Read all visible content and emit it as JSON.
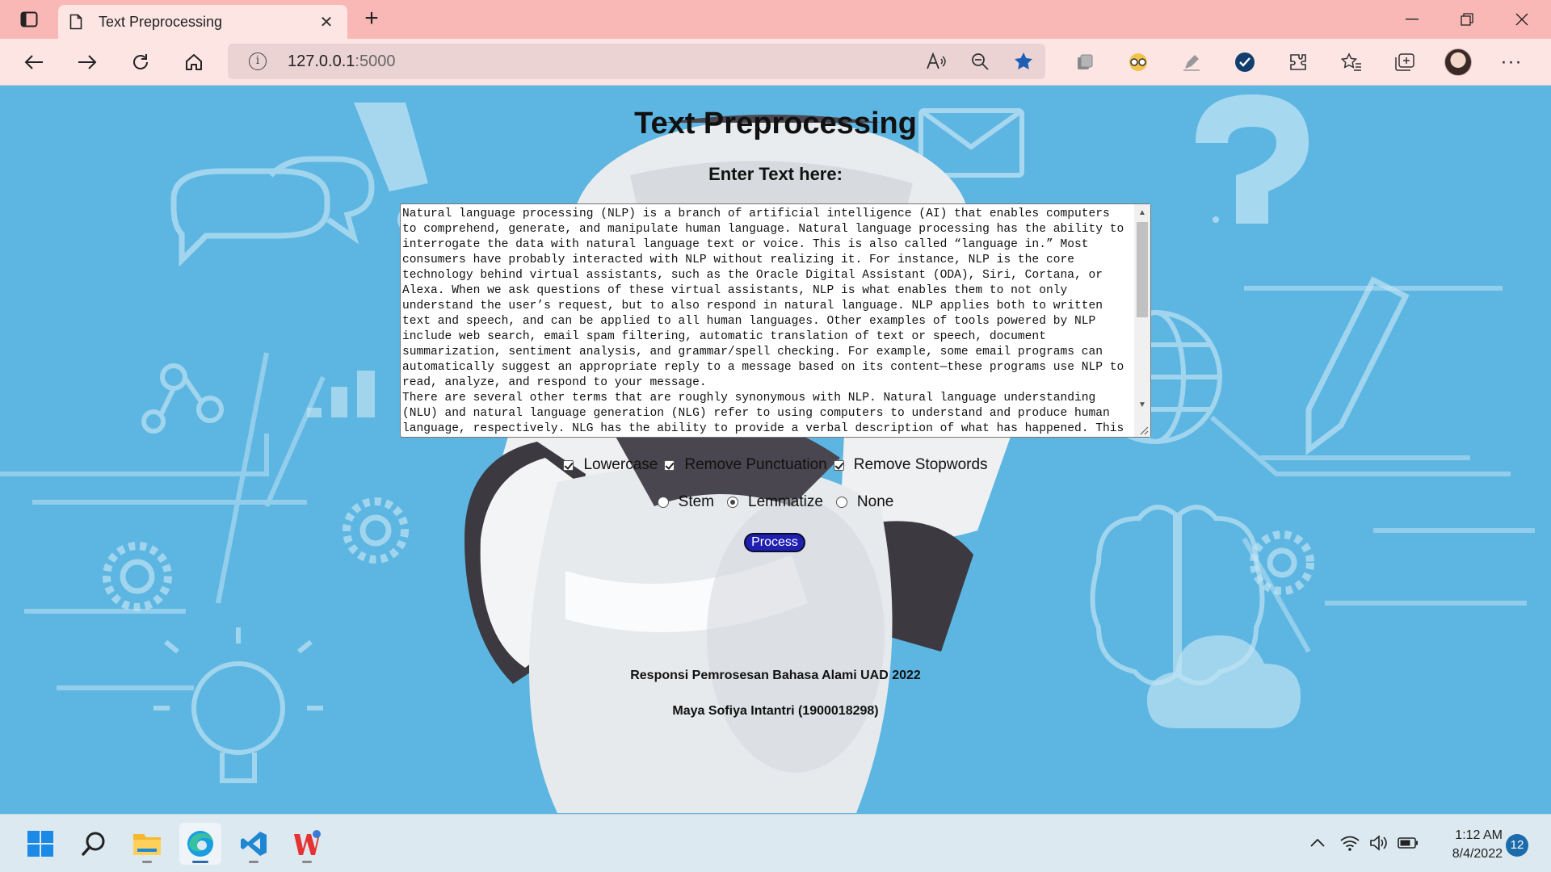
{
  "browser": {
    "tab_title": "Text Preprocessing",
    "url_host": "127.0.0.1",
    "url_port": ":5000"
  },
  "page": {
    "title": "Text Preprocessing",
    "subtitle": "Enter Text here:",
    "input_text": "Natural language processing (NLP) is a branch of artificial intelligence (AI) that enables computers to comprehend, generate, and manipulate human language. Natural language processing has the ability to interrogate the data with natural language text or voice. This is also called “language in.” Most consumers have probably interacted with NLP without realizing it. For instance, NLP is the core technology behind virtual assistants, such as the Oracle Digital Assistant (ODA), Siri, Cortana, or Alexa. When we ask questions of these virtual assistants, NLP is what enables them to not only understand the user’s request, but to also respond in natural language. NLP applies both to written text and speech, and can be applied to all human languages. Other examples of tools powered by NLP include web search, email spam filtering, automatic translation of text or speech, document summarization, sentiment analysis, and grammar/spell checking. For example, some email programs can automatically suggest an appropriate reply to a message based on its content—these programs use NLP to read, analyze, and respond to your message.\nThere are several other terms that are roughly synonymous with NLP. Natural language understanding (NLU) and natural language generation (NLG) refer to using computers to understand and produce human language, respectively. NLG has the ability to provide a verbal description of what has happened. This",
    "checkboxes": [
      {
        "label": "Lowercase",
        "checked": true
      },
      {
        "label": "Remove Punctuation",
        "checked": true
      },
      {
        "label": "Remove Stopwords",
        "checked": true
      }
    ],
    "radios": [
      {
        "label": "Stem",
        "selected": false
      },
      {
        "label": "Lemmatize",
        "selected": true
      },
      {
        "label": "None",
        "selected": false
      }
    ],
    "process_label": "Process",
    "footer_line1": "Responsi Pemrosesan Bahasa Alami UAD 2022",
    "footer_line2": "Maya Sofiya Intantri (1900018298)"
  },
  "taskbar": {
    "time": "1:12 AM",
    "date": "8/4/2022",
    "notifications": "12"
  },
  "colors": {
    "tabbar": "#f9b8b6",
    "toolbar": "#fde5e4",
    "page_bg": "#5db6e2",
    "process_button": "#1f1fb0"
  }
}
